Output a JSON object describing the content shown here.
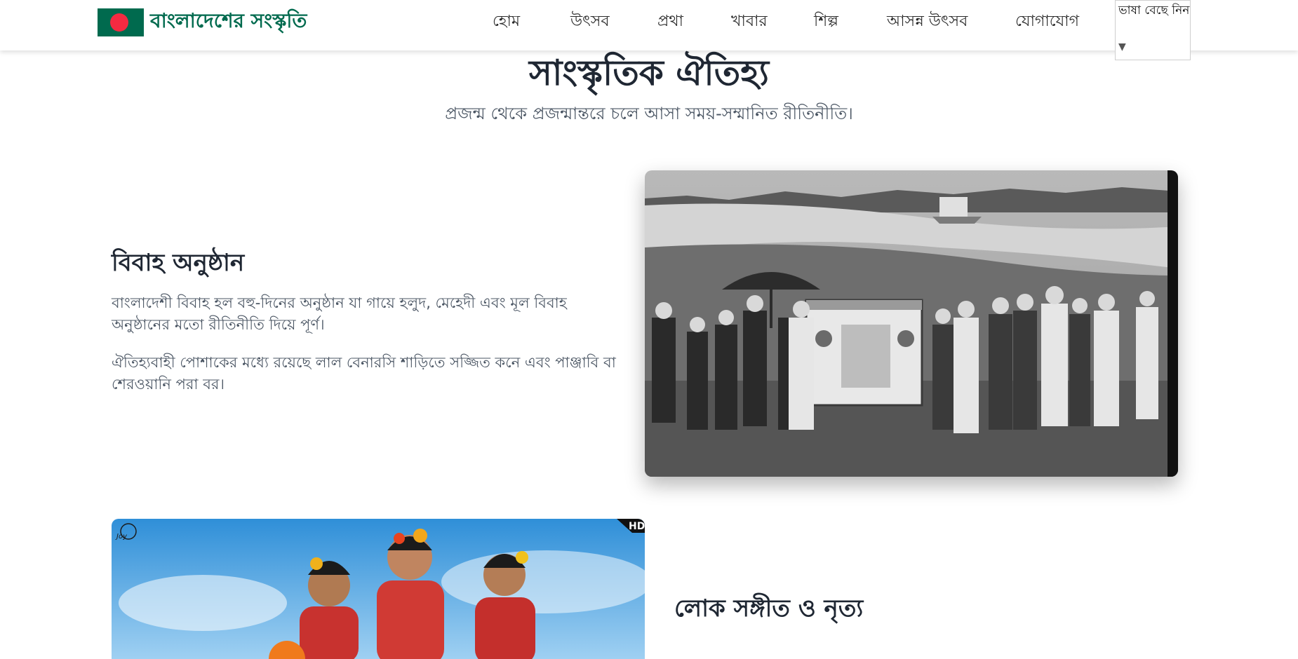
{
  "header": {
    "brand": "বাংলাদেশের সংস্কৃতি",
    "nav": [
      "হোম",
      "উৎসব",
      "প্রথা",
      "খাবার",
      "শিল্প",
      "আসন্ন উৎসব",
      "যোগাযোগ"
    ],
    "language_select_label": "ভাষা বেছে নিন"
  },
  "section": {
    "title": "সাংস্কৃতিক ঐতিহ্য",
    "subtitle": "প্রজন্ম থেকে প্রজন্মান্তরে চলে আসা সময়-সম্মানিত রীতিনীতি।"
  },
  "cards": [
    {
      "title": "বিবাহ অনুষ্ঠান",
      "paragraphs": [
        "বাংলাদেশী বিবাহ হল বহু-দিনের অনুষ্ঠান যা গায়ে হলুদ, মেহেদী এবং মূল বিবাহ অনুষ্ঠানের মতো রীতিনীতি দিয়ে পূর্ণ।",
        "ঐতিহ্যবাহী পোশাকের মধ্যে রয়েছে লাল বেনারসি শাড়িতে সজ্জিত কনে এবং পাঞ্জাবি বা শেরওয়ানি পরা বর।"
      ]
    },
    {
      "title": "লোক সঙ্গীত ও নৃত্য"
    }
  ],
  "photo2_overlay": {
    "hd_badge": "HD",
    "watermark": "Joy"
  },
  "colors": {
    "brand_green": "#006a4e",
    "flag_red": "#f42a41",
    "heading": "#1f2733",
    "body_text": "#4a5563"
  }
}
